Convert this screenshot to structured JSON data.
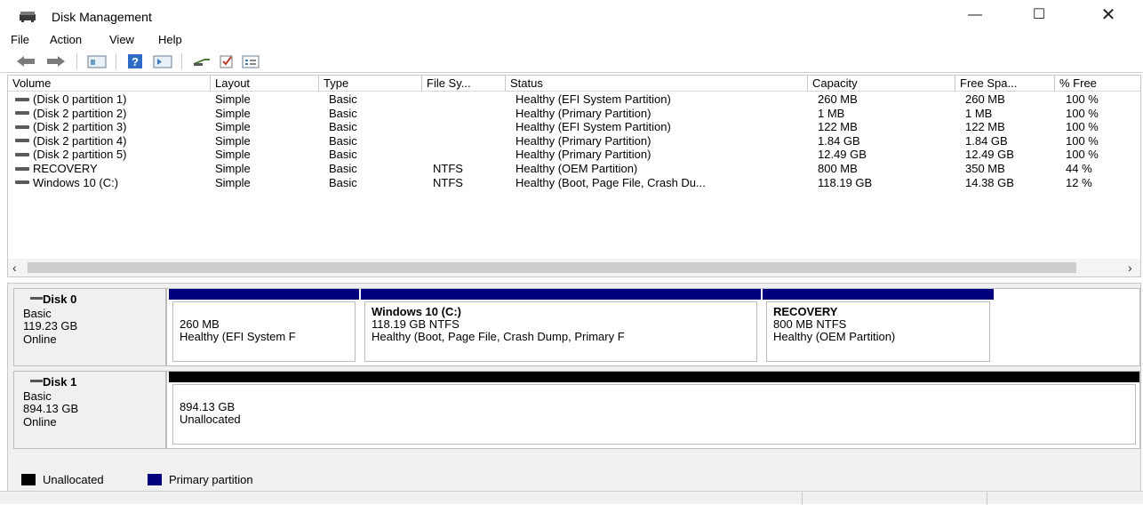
{
  "window": {
    "title": "Disk Management"
  },
  "menu": [
    "File",
    "Action",
    "View",
    "Help"
  ],
  "columns": [
    "Volume",
    "Layout",
    "Type",
    "File Sy...",
    "Status",
    "Capacity",
    "Free Spa...",
    "% Free"
  ],
  "volumes": [
    {
      "volume": "(Disk 0 partition 1)",
      "layout": "Simple",
      "type": "Basic",
      "fs": "",
      "status": "Healthy (EFI System Partition)",
      "capacity": "260 MB",
      "free": "260 MB",
      "pct": "100 %"
    },
    {
      "volume": "(Disk 2 partition 2)",
      "layout": "Simple",
      "type": "Basic",
      "fs": "",
      "status": "Healthy (Primary Partition)",
      "capacity": "1 MB",
      "free": "1 MB",
      "pct": "100 %"
    },
    {
      "volume": "(Disk 2 partition 3)",
      "layout": "Simple",
      "type": "Basic",
      "fs": "",
      "status": "Healthy (EFI System Partition)",
      "capacity": "122 MB",
      "free": "122 MB",
      "pct": "100 %"
    },
    {
      "volume": "(Disk 2 partition 4)",
      "layout": "Simple",
      "type": "Basic",
      "fs": "",
      "status": "Healthy (Primary Partition)",
      "capacity": "1.84 GB",
      "free": "1.84 GB",
      "pct": "100 %"
    },
    {
      "volume": "(Disk 2 partition 5)",
      "layout": "Simple",
      "type": "Basic",
      "fs": "",
      "status": "Healthy (Primary Partition)",
      "capacity": "12.49 GB",
      "free": "12.49 GB",
      "pct": "100 %"
    },
    {
      "volume": "RECOVERY",
      "layout": "Simple",
      "type": "Basic",
      "fs": "NTFS",
      "status": "Healthy (OEM Partition)",
      "capacity": "800 MB",
      "free": "350 MB",
      "pct": "44 %"
    },
    {
      "volume": "Windows 10 (C:)",
      "layout": "Simple",
      "type": "Basic",
      "fs": "NTFS",
      "status": "Healthy (Boot, Page File, Crash Du...",
      "capacity": "118.19 GB",
      "free": "14.38 GB",
      "pct": "12 %"
    }
  ],
  "disks": [
    {
      "name": "Disk 0",
      "kind": "Basic",
      "size": "119.23 GB",
      "state": "Online",
      "partitions": [
        {
          "title": "",
          "line1": "260 MB",
          "line2": "Healthy (EFI System F"
        },
        {
          "title": "Windows 10  (C:)",
          "line1": "118.19 GB NTFS",
          "line2": "Healthy (Boot, Page File, Crash Dump, Primary F"
        },
        {
          "title": "RECOVERY",
          "line1": "800 MB NTFS",
          "line2": "Healthy (OEM Partition)"
        }
      ]
    },
    {
      "name": "Disk 1",
      "kind": "Basic",
      "size": "894.13 GB",
      "state": "Online",
      "partitions": [
        {
          "title": "",
          "line1": "894.13 GB",
          "line2": "Unallocated"
        }
      ]
    }
  ],
  "legend": [
    "Unallocated",
    "Primary partition"
  ],
  "colors": {
    "primary": "#00007e",
    "unallocated": "#000000"
  }
}
